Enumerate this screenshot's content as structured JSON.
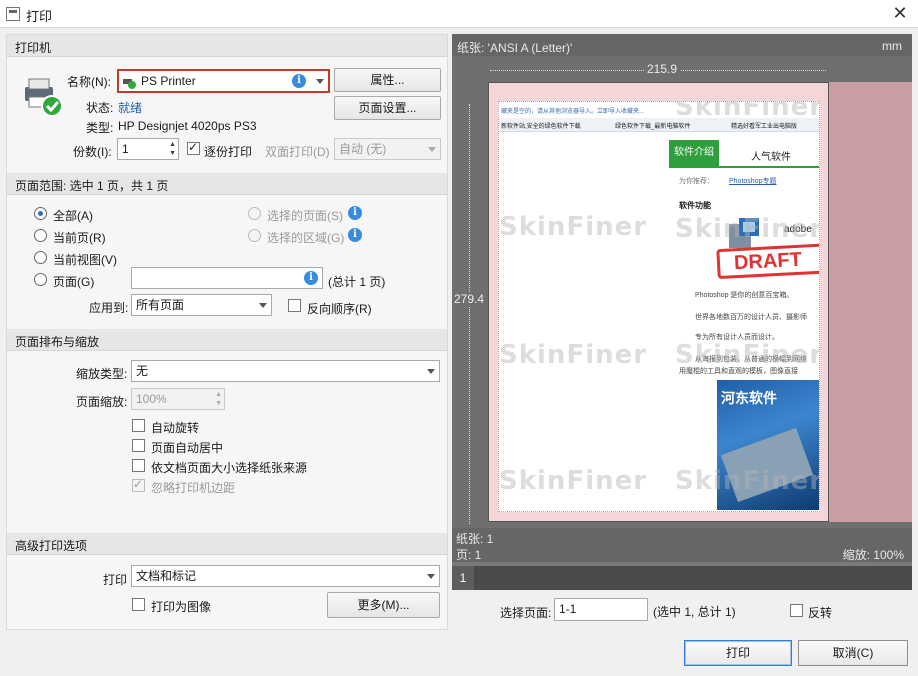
{
  "window": {
    "title": "打印",
    "close_glyph": "✕"
  },
  "printer": {
    "section_title": "打印机",
    "name_label": "名称(N):",
    "name_value": "PS Printer",
    "properties_button": "属性...",
    "status_label": "状态:",
    "status_value": "就绪",
    "type_label": "类型:",
    "type_value": "HP Designjet 4020ps PS3",
    "page_setup_button": "页面设置...",
    "copies_label": "份数(I):",
    "copies_value": "1",
    "collate_label": "逐份打印",
    "collate_checked": true,
    "duplex_label": "双面打印(D)",
    "duplex_value": "自动 (无)"
  },
  "page_range": {
    "section_title": "页面范围: 选中 1 页，共 1 页",
    "all": "全部(A)",
    "current_page": "当前页(R)",
    "current_view": "当前视图(V)",
    "pages": "页面(G)",
    "selected_pages": "选择的页面(S)",
    "selected_area": "选择的区域(G)",
    "total_text": "(总计 1 页)",
    "apply_to_label": "应用到:",
    "apply_to_value": "所有页面",
    "reverse_label": "反向顺序(R)"
  },
  "layout": {
    "section_title": "页面排布与缩放",
    "scale_type_label": "缩放类型:",
    "scale_type_value": "无",
    "page_scale_label": "页面缩放:",
    "page_scale_value": "100%",
    "auto_rotate": "自动旋转",
    "auto_center": "页面自动居中",
    "choose_paper": "依文档页面大小选择纸张来源",
    "ignore_margins": "忽略打印机边距"
  },
  "advanced": {
    "section_title": "高级打印选项",
    "print_label": "打印",
    "print_value": "文档和标记",
    "print_as_image": "打印为图像",
    "more_button": "更多(M)..."
  },
  "preview": {
    "paper_label": "纸张: 'ANSI A (Letter)'",
    "unit": "mm",
    "width_value": "215.9",
    "height_value": "279.4",
    "paper_count": "纸张: 1",
    "page_count": "页: 1",
    "zoom": "缩放: 100%",
    "page_number": "1",
    "watermark": "SkinFiner",
    "web": {
      "top_line": "藏夹是空的，请从其他浏览器导入。立即导入收藏夹...",
      "tab1": "新软件站,安全的绿色软件下载",
      "tab2": "绿色软件下载_最新电脑软件",
      "tab3": "精选好看军工业出电脑版",
      "nav1": "软件介绍",
      "nav2": "人气软件",
      "recommend": "为你推荐：",
      "recommend_link": "Photoshop专题",
      "features": "软件功能",
      "adobe": "adobe",
      "draft": "DRAFT",
      "line1": "Photoshop 是你的创意百宝箱。",
      "line2": "世界各地数百万的设计人员、摄影师",
      "line3": "专为所有设计人员而设计。",
      "line4": "从海报到包装，从普通的横幅到网络",
      "line5": "用魔棍的工具和直观的模板，图像直接",
      "brand": "河东软件"
    }
  },
  "footer": {
    "select_page_label": "选择页面:",
    "select_page_value": "1-1",
    "select_info": "(选中 1, 总计 1)",
    "reverse_label": "反转",
    "print_button": "打印",
    "cancel_button": "取消(C)"
  },
  "colors": {
    "accent": "#1b5fb0",
    "highlight_border": "#c0392b",
    "sheet_margin": "#f4d6d8"
  }
}
